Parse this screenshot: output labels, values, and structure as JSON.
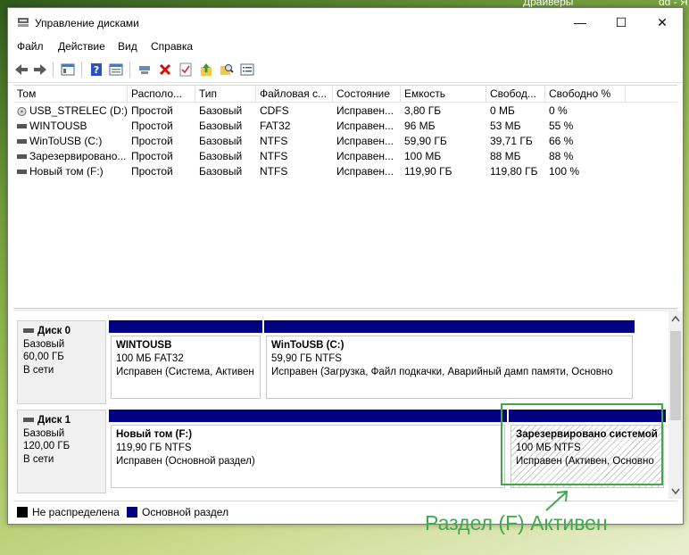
{
  "background": {
    "corner_text_left": "Драйверы",
    "corner_text_right": "dd - Я"
  },
  "window": {
    "title": "Управление дисками",
    "minimize": "—",
    "maximize": "☐",
    "close": "✕"
  },
  "menu": [
    "Файл",
    "Действие",
    "Вид",
    "Справка"
  ],
  "toolbar_icons": [
    "back-icon",
    "forward-icon",
    "console-tree-icon",
    "help-icon",
    "properties-icon",
    "connect-icon",
    "delete-icon",
    "check-icon",
    "up-folder-icon",
    "find-icon",
    "list-icon"
  ],
  "table": {
    "columns": [
      "Том",
      "Располо...",
      "Тип",
      "Файловая с...",
      "Состояние",
      "Емкость",
      "Свобод...",
      "Свободно %"
    ],
    "rows": [
      {
        "vol": "USB_STRELEC (D:)",
        "layout": "Простой",
        "type": "Базовый",
        "fs": "CDFS",
        "status": "Исправен...",
        "capacity": "3,80 ГБ",
        "free": "0 МБ",
        "pct": "0 %",
        "icon": "cd-drive-icon"
      },
      {
        "vol": "WINTOUSB",
        "layout": "Простой",
        "type": "Базовый",
        "fs": "FAT32",
        "status": "Исправен...",
        "capacity": "96 МБ",
        "free": "53 МБ",
        "pct": "55 %",
        "icon": "drive-icon"
      },
      {
        "vol": "WinToUSB (C:)",
        "layout": "Простой",
        "type": "Базовый",
        "fs": "NTFS",
        "status": "Исправен...",
        "capacity": "59,90 ГБ",
        "free": "39,71 ГБ",
        "pct": "66 %",
        "icon": "drive-icon"
      },
      {
        "vol": "Зарезервировано...",
        "layout": "Простой",
        "type": "Базовый",
        "fs": "NTFS",
        "status": "Исправен...",
        "capacity": "100 МБ",
        "free": "88 МБ",
        "pct": "88 %",
        "icon": "drive-icon"
      },
      {
        "vol": "Новый том (F:)",
        "layout": "Простой",
        "type": "Базовый",
        "fs": "NTFS",
        "status": "Исправен...",
        "capacity": "119,90 ГБ",
        "free": "119,80 ГБ",
        "pct": "100 %",
        "icon": "drive-icon"
      }
    ]
  },
  "disks": [
    {
      "name": "Диск 0",
      "type": "Базовый",
      "size": "60,00 ГБ",
      "state": "В сети",
      "partitions": [
        {
          "name": "WINTOUSB",
          "size": "100 МБ FAT32",
          "status": "Исправен (Система, Активен"
        },
        {
          "name": "WinToUSB  (C:)",
          "size": "59,90 ГБ NTFS",
          "status": "Исправен (Загрузка, Файл подкачки, Аварийный дамп памяти, Основно"
        }
      ]
    },
    {
      "name": "Диск 1",
      "type": "Базовый",
      "size": "120,00 ГБ",
      "state": "В сети",
      "partitions": [
        {
          "name": "Новый том  (F:)",
          "size": "119,90 ГБ NTFS",
          "status": "Исправен (Основной раздел)"
        },
        {
          "name": "Зарезервировано системой",
          "size": "100 МБ NTFS",
          "status": "Исправен (Активен, Основно"
        }
      ]
    }
  ],
  "legend": [
    {
      "label": "Не распределена",
      "color": "#000000"
    },
    {
      "label": "Основной раздел",
      "color": "#000080"
    }
  ],
  "annotation": {
    "text": "Раздел (F) Активен",
    "color": "#3fa94a"
  }
}
